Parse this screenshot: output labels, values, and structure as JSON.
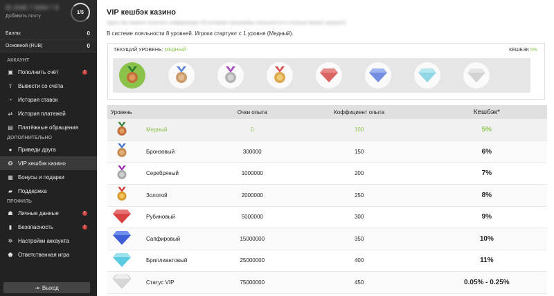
{
  "sidebar": {
    "user_id": "ID 2045 7 0054 7 8",
    "add_email": "Добавить почту",
    "level_progress": "1/5",
    "balances": [
      {
        "label": "Баллы",
        "value": "0"
      },
      {
        "label": "Основной (RUB)",
        "value": "0"
      }
    ],
    "sections": {
      "account": "Аккаунт",
      "additional": "Дополнительно",
      "profile": "Профиль"
    },
    "account_items": [
      {
        "label": "Пополнить счёт",
        "icon": "wallet-icon",
        "badge": "!"
      },
      {
        "label": "Вывести со счёта",
        "icon": "upload-icon"
      },
      {
        "label": "История ставок",
        "icon": "history-icon"
      },
      {
        "label": "История платежей",
        "icon": "swap-icon"
      },
      {
        "label": "Платёжные обращения",
        "icon": "ticket-icon"
      }
    ],
    "additional_items": [
      {
        "label": "Приведи друга",
        "icon": "friends-icon"
      },
      {
        "label": "VIP кешбэк казино",
        "icon": "vip-icon",
        "active": true
      },
      {
        "label": "Бонусы и подарки",
        "icon": "gift-icon"
      },
      {
        "label": "Поддержка",
        "icon": "chat-icon"
      }
    ],
    "profile_items": [
      {
        "label": "Личные данные",
        "icon": "user-icon",
        "badge": "!"
      },
      {
        "label": "Безопасность",
        "icon": "lock-icon",
        "badge": "!"
      },
      {
        "label": "Настройки аккаунта",
        "icon": "gear-icon"
      },
      {
        "label": "Ответственная игра",
        "icon": "shield-icon"
      }
    ],
    "logout_label": "Выход"
  },
  "main": {
    "title": "VIP кешбэк казино",
    "blurred_description": "Здесь Вы можете получить информацию об условиях программы лояльности и статусах вашего аккаунта",
    "system_description": "В системе лояльности 8 уровней. Игроки стартуют с 1 уровня (Медный).",
    "current_level_label": "Текущий уровень:",
    "current_level_value": "Медный",
    "cashback_label": "Кешбэк",
    "cashback_value": "5%",
    "table_headers": {
      "level": "Уровень",
      "points": "Очки опыта",
      "coef": "Коффициент опыта",
      "cashback": "Кешбэк*"
    },
    "levels": [
      {
        "name": "Медный",
        "points": "0",
        "coef": "100",
        "cashback": "5%",
        "icon": "copper-medal-icon",
        "current": true
      },
      {
        "name": "Бронзовый",
        "points": "300000",
        "coef": "150",
        "cashback": "6%",
        "icon": "bronze-medal-icon"
      },
      {
        "name": "Серебряный",
        "points": "1000000",
        "coef": "200",
        "cashback": "7%",
        "icon": "silver-medal-icon"
      },
      {
        "name": "Золотой",
        "points": "2000000",
        "coef": "250",
        "cashback": "8%",
        "icon": "gold-medal-icon"
      },
      {
        "name": "Рубиновый",
        "points": "5000000",
        "coef": "300",
        "cashback": "9%",
        "icon": "ruby-icon"
      },
      {
        "name": "Сапфировый",
        "points": "15000000",
        "coef": "350",
        "cashback": "10%",
        "icon": "sapphire-icon"
      },
      {
        "name": "Бриллиантовый",
        "points": "25000000",
        "coef": "400",
        "cashback": "11%",
        "icon": "diamond-icon"
      },
      {
        "name": "Статус VIP",
        "points": "75000000",
        "coef": "450",
        "cashback": "0.05% - 0.25%",
        "icon": "vip-diamond-icon"
      }
    ]
  },
  "colors": {
    "accent": "#8bc34a",
    "sidebar_bg": "#222222",
    "badge": "#c94343"
  }
}
